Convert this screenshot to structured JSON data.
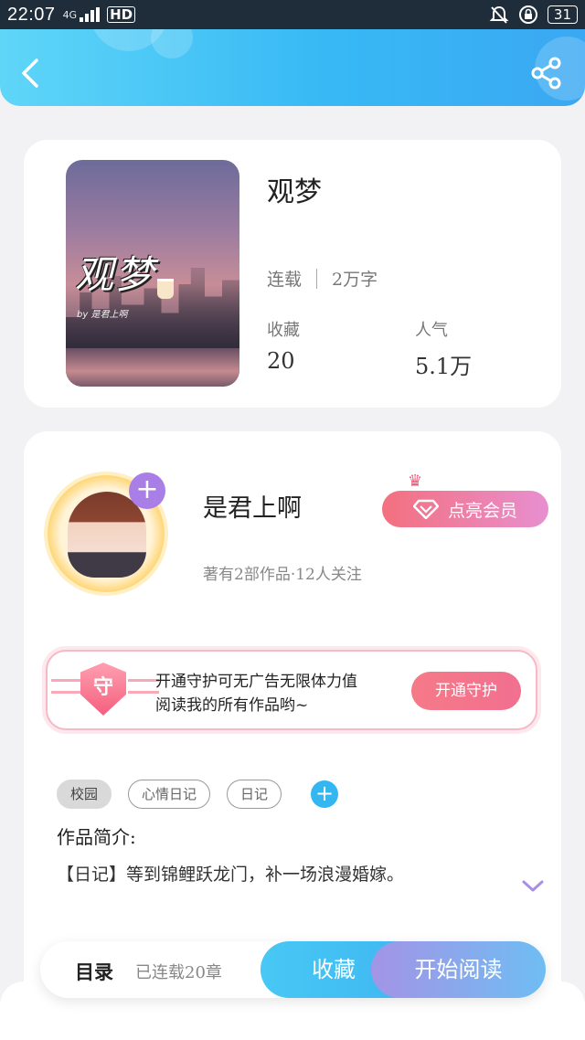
{
  "status_bar": {
    "time": "22:07",
    "signal": "4G",
    "hd": "HD",
    "battery": "31"
  },
  "header": {
    "back_icon": "back-arrow-icon",
    "share_icon": "share-icon",
    "accent_color": "#38b9f5"
  },
  "book": {
    "cover_title": "观梦",
    "cover_author": "by 是君上啊",
    "title": "观梦",
    "status": "连载",
    "word_count": "2万字",
    "favorites_label": "收藏",
    "favorites_value": "20",
    "popularity_label": "人气",
    "popularity_value": "5.1万"
  },
  "author": {
    "name": "是君上啊",
    "stats": "著有2部作品·12人关注",
    "follow_icon": "plus-icon",
    "vip_button": "点亮会员"
  },
  "guard": {
    "badge": "守",
    "line1": "开通守护可无广告无限体力值",
    "line2": "阅读我的所有作品哟~",
    "button": "开通守护"
  },
  "tags": {
    "items": [
      "校园",
      "心情日记",
      "日记"
    ],
    "add": "+"
  },
  "intro": {
    "label": "作品简介:",
    "text": "【日记】等到锦鲤跃龙门，补一场浪漫婚嫁。"
  },
  "action_bar": {
    "toc_label": "目录",
    "toc_count": "已连载20章",
    "favorite_button": "收藏",
    "read_button": "开始阅读"
  }
}
